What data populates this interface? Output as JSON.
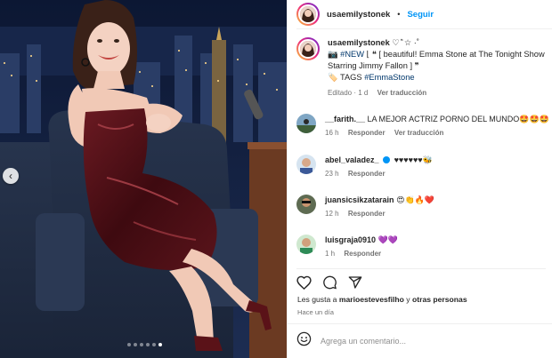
{
  "post": {
    "username": "usaemilystonek",
    "separator": "•",
    "follow_label": "Seguir",
    "caption": {
      "username": "usaemilystonek",
      "line1": "♡ ͛̈ ☆ ·˚",
      "line2_prefix": "📷",
      "line2_tag": "#NEW",
      "line2_rest": "⌊ ❝ [ beautiful! Emma Stone at The Tonight Show Starring Jimmy Fallon ] ❞",
      "line3_prefix": "🏷️ TAGS",
      "line3_tag": "#EmmaStone",
      "time": "Editado · 1 d",
      "see_translation": "Ver traducción"
    },
    "comments": [
      {
        "username": "__farith.__",
        "text": "LA MEJOR ACTRIZ PORNO DEL MUNDO🤩🤩🤩",
        "time": "16 h",
        "reply": "Responder",
        "translate": "Ver traducción"
      },
      {
        "username": "abel_valadez_",
        "text": "♥♥♥♥♥♥🐝",
        "time": "23 h",
        "reply": "Responder",
        "verified": true
      },
      {
        "username": "juansicsikzatarain",
        "text": "😍👏🔥❤️",
        "time": "12 h",
        "reply": "Responder"
      },
      {
        "username": "luisgraja0910",
        "text": "💜💜",
        "time": "1 h",
        "reply": "Responder"
      }
    ],
    "likes_prefix": "Les gusta a",
    "likes_user": "marioestevesfilho",
    "likes_and": "y",
    "likes_others": "otras personas",
    "posted_ago": "Hace un día",
    "add_comment_placeholder": "Agrega un comentario...",
    "carousel": {
      "count": 6,
      "active_index": 5
    }
  },
  "icons": {
    "like": "heart-icon",
    "comment": "comment-icon",
    "share": "share-icon",
    "emoji": "emoji-icon",
    "prev": "chevron-left-icon"
  },
  "colors": {
    "link_blue": "#0095f6",
    "hashtag": "#00376b",
    "muted": "#737373",
    "dress": "#4a0f14",
    "background_night": "#0f1a33"
  }
}
